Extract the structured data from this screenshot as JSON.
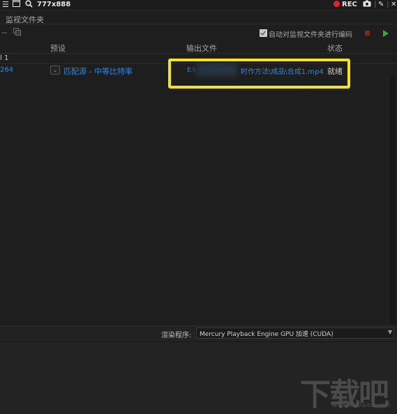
{
  "recorder": {
    "size_label": "777x888",
    "rec_label": "REC"
  },
  "panel": {
    "tab_label": "监视文件夹"
  },
  "toolbar": {
    "auto_encode_label": "自动对监视文件夹进行编码",
    "auto_encode_checked": true
  },
  "table": {
    "headers": {
      "preset": "预设",
      "output": "输出文件",
      "status": "状态"
    },
    "group_label": "l 1",
    "rows": [
      {
        "format": "264",
        "preset": "匹配源 - 中等比特率",
        "output_drive": "E:\\",
        "output_path": "时作方法\\成品\\合成1.mp4",
        "status": "就绪"
      }
    ]
  },
  "renderer": {
    "label": "渲染程序:",
    "value": "Mercury Playback Engine GPU 加速 (CUDA)"
  },
  "watermark": {
    "text": "下载吧",
    "url": "www.xiazaiba.com"
  },
  "colors": {
    "highlight": "#f5e60f",
    "link_blue": "#2f86db",
    "rec_red": "#e81e25",
    "play_green": "#2eaf38"
  }
}
